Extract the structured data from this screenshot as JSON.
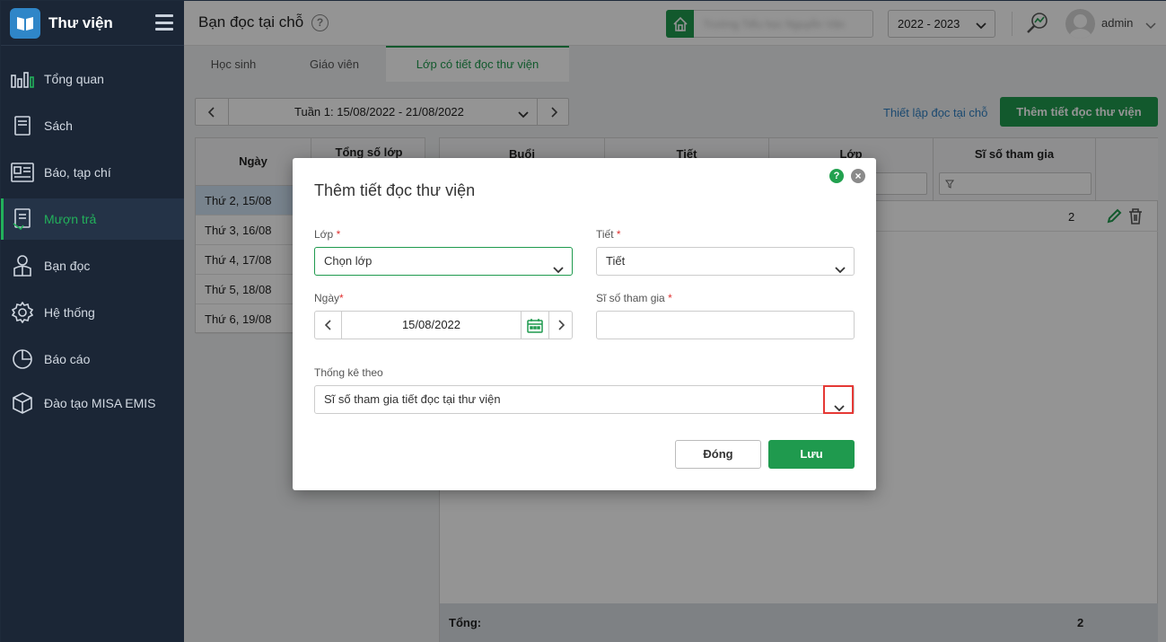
{
  "app": {
    "title": "Thư viện"
  },
  "sidebar": {
    "items": [
      {
        "label": "Tổng quan",
        "icon": "bar-chart-icon"
      },
      {
        "label": "Sách",
        "icon": "book-icon"
      },
      {
        "label": "Báo, tạp chí",
        "icon": "newspaper-icon"
      },
      {
        "label": "Mượn trả",
        "icon": "borrow-icon",
        "active": true
      },
      {
        "label": "Bạn đọc",
        "icon": "reader-icon"
      },
      {
        "label": "Hệ thống",
        "icon": "gear-icon"
      },
      {
        "label": "Báo cáo",
        "icon": "pie-chart-icon"
      },
      {
        "label": "Đào tạo MISA EMIS",
        "icon": "box-icon"
      }
    ]
  },
  "header": {
    "title": "Bạn đọc tại chỗ",
    "help": "?",
    "school_name": "Trường Tiểu học Nguyễn Văn",
    "year": "2022 - 2023",
    "user": "admin"
  },
  "tabs": [
    {
      "label": "Học sinh"
    },
    {
      "label": "Giáo viên"
    },
    {
      "label": "Lớp có tiết đọc thư viện",
      "active": true
    }
  ],
  "toolbar": {
    "week": "Tuần 1: 15/08/2022 - 21/08/2022",
    "setup_link": "Thiết lập đọc tại chỗ",
    "add_button": "Thêm tiết đọc thư viện"
  },
  "left_table": {
    "headers": [
      "Ngày",
      "Tổng số lớp"
    ],
    "rows": [
      "Thứ 2, 15/08",
      "Thứ 3, 16/08",
      "Thứ 4, 17/08",
      "Thứ 5, 18/08",
      "Thứ 6, 19/08"
    ]
  },
  "right_table": {
    "headers": [
      "Buổi",
      "Tiết",
      "Lớp",
      "Sĩ số tham gia"
    ],
    "row_value": "2",
    "footer_label": "Tổng:",
    "footer_value": "2"
  },
  "dialog": {
    "title": "Thêm tiết đọc thư viện",
    "help": "?",
    "close": "×",
    "class_label": "Lớp",
    "class_placeholder": "Chọn lớp",
    "period_label": "Tiết",
    "period_placeholder": "Tiết",
    "date_label": "Ngày",
    "date_value": "15/08/2022",
    "attendance_label": "Sĩ số tham gia",
    "attendance_value": "",
    "stat_label": "Thống kê theo",
    "stat_value": "Sĩ số tham gia tiết đọc tại thư viện",
    "required_mark": "*",
    "close_button": "Đóng",
    "save_button": "Lưu"
  },
  "colors": {
    "brand_green": "#1f9a4e",
    "sidebar_bg": "#1b2636",
    "link_blue": "#2f7fc1",
    "highlight_red": "#e53935"
  }
}
